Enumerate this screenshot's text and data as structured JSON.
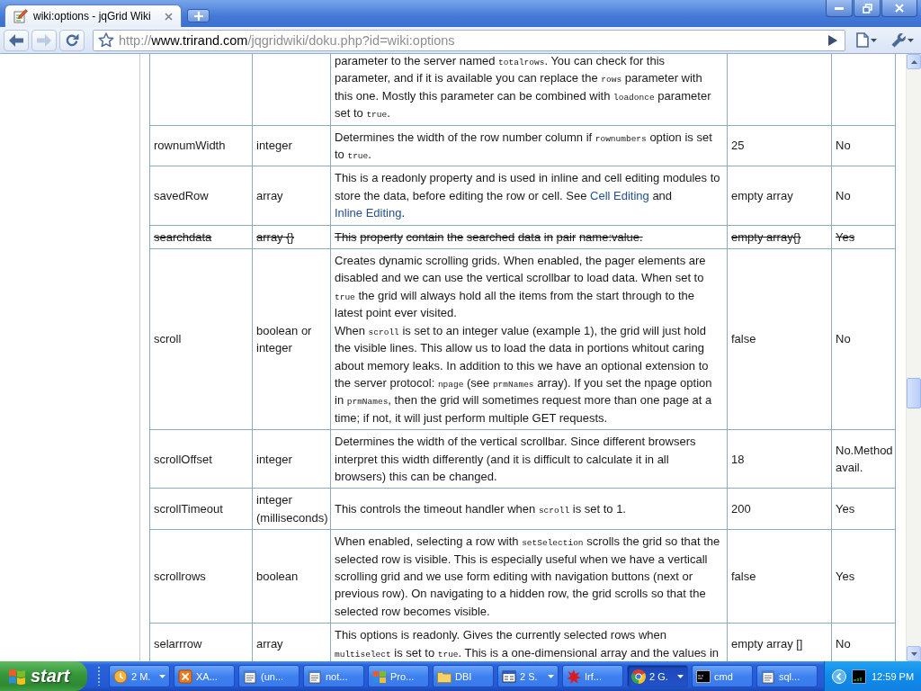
{
  "browser": {
    "tab": {
      "title": "wiki:options - jqGrid Wiki"
    },
    "back": {
      "disabled": false
    },
    "forward": {
      "disabled": true
    },
    "address": {
      "scheme": "http://",
      "host": "www.trirand.com",
      "path": "/jqgridwiki/doku.php?id=wiki:options"
    }
  },
  "table": {
    "rows": [
      {
        "struck": false,
        "column_3": [
          [
            {
              "kind": "text",
              "text": "parameter to the server named "
            },
            {
              "kind": "code",
              "text": "totalrows"
            },
            {
              "kind": "text",
              "text": ". You can check for this parameter, and if it is available you can replace the "
            },
            {
              "kind": "code",
              "text": "rows"
            },
            {
              "kind": "text",
              "text": " parameter with this one. Mostly this parameter can be combined with "
            },
            {
              "kind": "code",
              "text": "loadonce"
            },
            {
              "kind": "text",
              "text": " parameter set to "
            },
            {
              "kind": "code",
              "text": "true"
            },
            {
              "kind": "text",
              "text": "."
            }
          ]
        ]
      },
      {
        "struck": false,
        "column_1": "rownumWidth",
        "column_2": "integer",
        "column_3": [
          [
            {
              "kind": "text",
              "text": "Determines the width of the row number column if "
            },
            {
              "kind": "code",
              "text": "rownumbers"
            },
            {
              "kind": "text",
              "text": " option is set to "
            },
            {
              "kind": "code",
              "text": "true"
            },
            {
              "kind": "text",
              "text": "."
            }
          ]
        ],
        "column_4": "25",
        "column_5": "No"
      },
      {
        "struck": false,
        "column_1": "savedRow",
        "column_2": "array",
        "column_3": [
          [
            {
              "kind": "text",
              "text": "This is a readonly property and is used in inline and cell editing modules to store the data, before editing the row or cell. See "
            },
            {
              "kind": "link",
              "text": "Cell Editing"
            },
            {
              "kind": "text",
              "text": " and "
            },
            {
              "kind": "link",
              "text": "Inline Editing"
            },
            {
              "kind": "text",
              "text": "."
            }
          ]
        ],
        "column_4": "empty array",
        "column_5": "No"
      },
      {
        "struck": true,
        "column_1": "searchdata",
        "column_2": "array {}",
        "column_3": [
          [
            {
              "kind": "text",
              "text": "This property contain the searched data in pair name:value."
            }
          ]
        ],
        "column_4": "empty array{}",
        "column_5": "Yes"
      },
      {
        "struck": false,
        "column_1": "scroll",
        "column_2": "boolean or integer",
        "column_3": [
          [
            {
              "kind": "text",
              "text": "Creates dynamic scrolling grids. When enabled, the pager elements are disabled and we can use the vertical scrollbar to load data. When set to "
            },
            {
              "kind": "code",
              "text": "true"
            },
            {
              "kind": "text",
              "text": " the grid will always hold all the items from the start through to the latest point ever visited."
            }
          ],
          [
            {
              "kind": "text",
              "text": "When "
            },
            {
              "kind": "code",
              "text": "scroll"
            },
            {
              "kind": "text",
              "text": " is set to an integer value (example 1), the grid will just hold the visible lines. This allow us to load the data in portions whitout caring about memory leaks. In addition to this we have an optional extension to the server protocol: "
            },
            {
              "kind": "code",
              "text": "npage"
            },
            {
              "kind": "text",
              "text": " (see "
            },
            {
              "kind": "code",
              "text": "prmNames"
            },
            {
              "kind": "text",
              "text": " array). If you set the npage option in "
            },
            {
              "kind": "code",
              "text": "prmNames"
            },
            {
              "kind": "text",
              "text": ", then the grid will sometimes request more than one page at a time; if not, it will just perform multiple GET requests."
            }
          ]
        ],
        "column_4": "false",
        "column_5": "No"
      },
      {
        "struck": false,
        "column_1": "scrollOffset",
        "column_2": "integer",
        "column_3": [
          [
            {
              "kind": "text",
              "text": "Determines the width of the vertical scrollbar. Since different browsers interpret this width differently (and it is difficult to calculate it in all browsers) this can be changed."
            }
          ]
        ],
        "column_4": "18",
        "column_5": "No.Method avail."
      },
      {
        "struck": false,
        "column_1": "scrollTimeout",
        "column_2": "integer (milliseconds)",
        "column_3": [
          [
            {
              "kind": "text",
              "text": "This controls the timeout handler when "
            },
            {
              "kind": "code",
              "text": "scroll"
            },
            {
              "kind": "text",
              "text": " is set to 1."
            }
          ]
        ],
        "column_4": "200",
        "column_5": "Yes"
      },
      {
        "struck": false,
        "column_1": "scrollrows",
        "column_2": "boolean",
        "column_3": [
          [
            {
              "kind": "text",
              "text": "When enabled, selecting a row with "
            },
            {
              "kind": "code",
              "text": "setSelection"
            },
            {
              "kind": "text",
              "text": " scrolls the grid so that the selected row is visible. This is especially useful when we have a verticall scrolling grid and we use form editing with navigation buttons (next or previous row). On navigating to a hidden row, the grid scrolls so that the selected row becomes visible."
            }
          ]
        ],
        "column_4": "false",
        "column_5": "Yes"
      },
      {
        "struck": false,
        "column_1": "selarrrow",
        "column_2": "array",
        "column_3": [
          [
            {
              "kind": "text",
              "text": "This options is readonly. Gives the currently selected rows when "
            },
            {
              "kind": "code",
              "text": "multiselect"
            },
            {
              "kind": "text",
              "text": " is set to "
            },
            {
              "kind": "code",
              "text": "true"
            },
            {
              "kind": "text",
              "text": ". This is a one-dimensional array and the values in"
            }
          ]
        ],
        "column_4": "empty array []",
        "column_5": "No"
      }
    ]
  },
  "taskbar": {
    "start_label": "start",
    "tasks": [
      {
        "label": "2 M.",
        "kind": "clock",
        "grouped": true,
        "selected": false
      },
      {
        "label": "XA...",
        "kind": "x-square",
        "grouped": false,
        "selected": false
      },
      {
        "label": "(un...",
        "kind": "notepad",
        "grouped": false,
        "selected": false
      },
      {
        "label": "not...",
        "kind": "notepad",
        "grouped": false,
        "selected": false
      },
      {
        "label": "Pro...",
        "kind": "flag",
        "grouped": false,
        "selected": false
      },
      {
        "label": "DBI",
        "kind": "folder",
        "grouped": false,
        "selected": false
      },
      {
        "label": "2 S.",
        "kind": "window",
        "grouped": true,
        "selected": false
      },
      {
        "label": "Irf...",
        "kind": "splash",
        "grouped": false,
        "selected": false
      },
      {
        "label": "2 G.",
        "kind": "circle-logo",
        "grouped": true,
        "selected": true
      },
      {
        "label": "cmd",
        "kind": "terminal",
        "grouped": false,
        "selected": false
      },
      {
        "label": "sql...",
        "kind": "notepad",
        "grouped": false,
        "selected": false
      }
    ],
    "clock": "12:59 PM"
  }
}
